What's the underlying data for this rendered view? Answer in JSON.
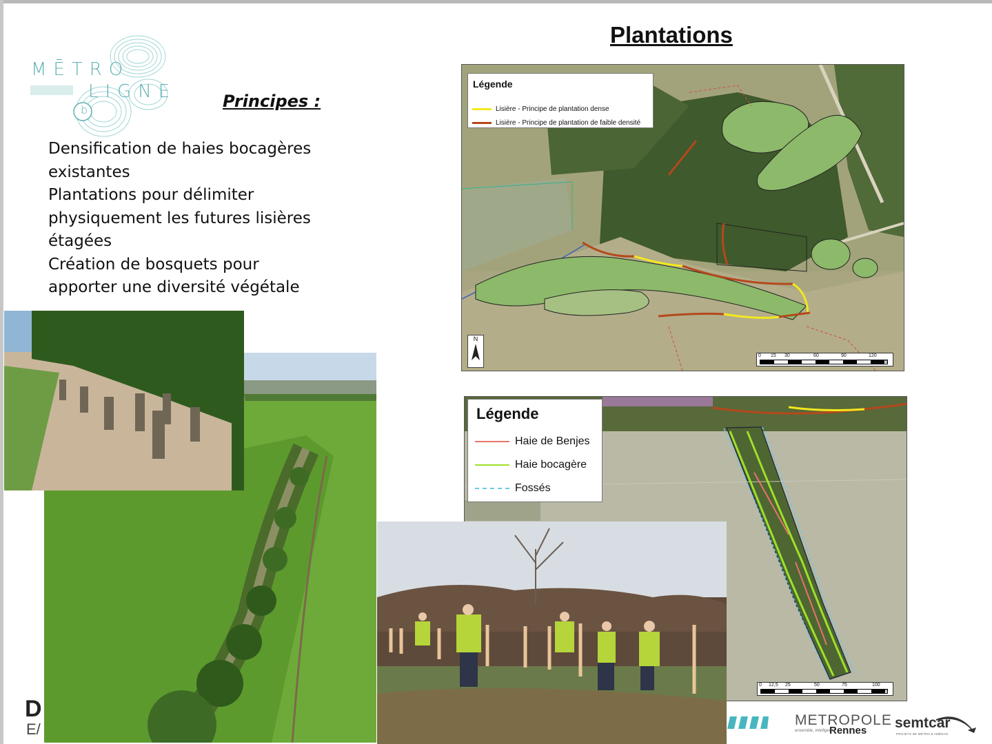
{
  "logo": {
    "line1": "MĒTRO",
    "line2": "LIGNE",
    "line3": "b"
  },
  "principes": {
    "heading": "Principes :",
    "lines": [
      "Densification de haies bocagères",
      "existantes",
      "Plantations pour délimiter",
      "physiquement les futures lisières",
      "étagées",
      "Création de bosquets pour",
      "apporter une diversité végétale"
    ]
  },
  "title": "Plantations",
  "map1": {
    "legend_title": "Légende",
    "legend_items": [
      {
        "label": "Lisière - Principe de plantation dense",
        "color": "#f4e81c"
      },
      {
        "label": "Lisière - Principe de plantation de faible densité",
        "color": "#b5481c"
      }
    ],
    "scale_ticks": [
      "0",
      "15",
      "30",
      "60",
      "90",
      "120"
    ],
    "scale_unit": "Meters",
    "north_label": "N"
  },
  "map2": {
    "legend_title": "Légende",
    "legend_items": [
      {
        "label": "Haie de Benjes",
        "color": "#e8736b"
      },
      {
        "label": "Haie bocagère",
        "color": "#9fe02a"
      },
      {
        "label": "Fossés",
        "color": "#6cc8e8"
      }
    ],
    "scale_ticks": [
      "0",
      "12,5",
      "25",
      "50",
      "75",
      "100"
    ],
    "scale_unit": "Meters"
  },
  "footer": {
    "d_letter": "D",
    "e_letter": "E/",
    "metropole": "METROPOLE",
    "rennes": "Rennes",
    "metropole_tagline": "ensemble, intelligente",
    "semtcar": "semtcar",
    "semtcar_tagline": "PROJETS DE MÉTRO & AMÉNAG."
  }
}
